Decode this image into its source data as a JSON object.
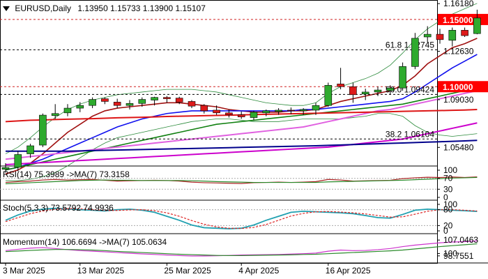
{
  "header": {
    "symbol": "EURUSD,Daily",
    "ohlc": "1.13950 1.15733 1.13900 1.15107"
  },
  "colors": {
    "bull": "#2eaa2e",
    "bear": "#dd1a1a",
    "ma_red": "#a01010",
    "ma_blue": "#1010ee",
    "ma_green": "#108010",
    "ma_pink": "#e060e0",
    "ma_darkred": "#dd1515",
    "ma_magenta": "#cc00cc",
    "ma_navy": "#00008b",
    "bb": "#2a8a3a",
    "grid": "#c0c0c0",
    "level_line": "#d02020",
    "price_tag_bg": "#ff0000",
    "rsi": "#aa2222",
    "rsi_ma": "#2a8a2a",
    "stoch_main": "#20a0b0",
    "stoch_signal": "#dd2222",
    "mom": "#cc33cc",
    "mom_ma": "#2a8a2a"
  },
  "chart_data": {
    "type": "candlestick",
    "x_ticks": [
      "3 Mar 2025",
      "13 Mar 2025",
      "25 Mar 2025",
      "4 Apr 2025",
      "16 Apr 2025"
    ],
    "y_ticks": [
      "1.16180",
      "1.12630",
      "1.09030",
      "1.05480"
    ],
    "ylim": [
      1.0425,
      1.1645
    ],
    "candles": [
      {
        "o": 1.0385,
        "h": 1.043,
        "l": 1.036,
        "c": 1.0398
      },
      {
        "o": 1.04,
        "h": 1.052,
        "l": 1.037,
        "c": 1.0495
      },
      {
        "o": 1.05,
        "h": 1.0575,
        "l": 1.047,
        "c": 1.056
      },
      {
        "o": 1.0565,
        "h": 1.08,
        "l": 1.055,
        "c": 1.0788
      },
      {
        "o": 1.0785,
        "h": 1.087,
        "l": 1.076,
        "c": 1.08
      },
      {
        "o": 1.0805,
        "h": 1.087,
        "l": 1.078,
        "c": 1.084
      },
      {
        "o": 1.084,
        "h": 1.0885,
        "l": 1.081,
        "c": 1.086
      },
      {
        "o": 1.086,
        "h": 1.092,
        "l": 1.084,
        "c": 1.0905
      },
      {
        "o": 1.091,
        "h": 1.092,
        "l": 1.087,
        "c": 1.089
      },
      {
        "o": 1.0885,
        "h": 1.091,
        "l": 1.084,
        "c": 1.086
      },
      {
        "o": 1.086,
        "h": 1.09,
        "l": 1.083,
        "c": 1.0875
      },
      {
        "o": 1.0875,
        "h": 1.092,
        "l": 1.085,
        "c": 1.0905
      },
      {
        "o": 1.09,
        "h": 1.0925,
        "l": 1.086,
        "c": 1.092
      },
      {
        "o": 1.092,
        "h": 1.093,
        "l": 1.088,
        "c": 1.091
      },
      {
        "o": 1.0915,
        "h": 1.0925,
        "l": 1.087,
        "c": 1.0885
      },
      {
        "o": 1.089,
        "h": 1.09,
        "l": 1.084,
        "c": 1.0855
      },
      {
        "o": 1.086,
        "h": 1.087,
        "l": 1.08,
        "c": 1.082
      },
      {
        "o": 1.0825,
        "h": 1.086,
        "l": 1.079,
        "c": 1.0805
      },
      {
        "o": 1.0805,
        "h": 1.083,
        "l": 1.077,
        "c": 1.079
      },
      {
        "o": 1.079,
        "h": 1.0815,
        "l": 1.076,
        "c": 1.0775
      },
      {
        "o": 1.077,
        "h": 1.082,
        "l": 1.075,
        "c": 1.081
      },
      {
        "o": 1.0805,
        "h": 1.083,
        "l": 1.078,
        "c": 1.082
      },
      {
        "o": 1.0815,
        "h": 1.084,
        "l": 1.079,
        "c": 1.0825
      },
      {
        "o": 1.0825,
        "h": 1.0845,
        "l": 1.0795,
        "c": 1.082
      },
      {
        "o": 1.082,
        "h": 1.084,
        "l": 1.079,
        "c": 1.083
      },
      {
        "o": 1.0825,
        "h": 1.088,
        "l": 1.079,
        "c": 1.086
      },
      {
        "o": 1.086,
        "h": 1.103,
        "l": 1.085,
        "c": 1.101
      },
      {
        "o": 1.102,
        "h": 1.114,
        "l": 1.098,
        "c": 1.1
      },
      {
        "o": 1.1,
        "h": 1.103,
        "l": 1.088,
        "c": 1.094
      },
      {
        "o": 1.0945,
        "h": 1.0985,
        "l": 1.09,
        "c": 1.096
      },
      {
        "o": 1.096,
        "h": 1.1,
        "l": 1.093,
        "c": 1.0975
      },
      {
        "o": 1.097,
        "h": 1.101,
        "l": 1.094,
        "c": 1.099
      },
      {
        "o": 1.099,
        "h": 1.118,
        "l": 1.097,
        "c": 1.115
      },
      {
        "o": 1.115,
        "h": 1.14,
        "l": 1.113,
        "c": 1.136
      },
      {
        "o": 1.137,
        "h": 1.145,
        "l": 1.133,
        "c": 1.139
      },
      {
        "o": 1.139,
        "h": 1.143,
        "l": 1.132,
        "c": 1.135
      },
      {
        "o": 1.1345,
        "h": 1.144,
        "l": 1.13,
        "c": 1.142
      },
      {
        "o": 1.142,
        "h": 1.144,
        "l": 1.137,
        "c": 1.138
      },
      {
        "o": 1.1395,
        "h": 1.1573,
        "l": 1.139,
        "c": 1.1511
      }
    ],
    "ma_lines": [
      {
        "color": "ma_red",
        "values": [
          1.035,
          1.038,
          1.043,
          1.05,
          1.058,
          1.066,
          1.072,
          1.078,
          1.082,
          1.084,
          1.085,
          1.086,
          1.087,
          1.088,
          1.088,
          1.087,
          1.086,
          1.085,
          1.083,
          1.082,
          1.081,
          1.081,
          1.081,
          1.082,
          1.082,
          1.083,
          1.086,
          1.089,
          1.091,
          1.093,
          1.095,
          1.097,
          1.101,
          1.108,
          1.117,
          1.123,
          1.129,
          1.132,
          1.136
        ]
      },
      {
        "color": "ma_blue",
        "values": [
          1.038,
          1.04,
          1.043,
          1.046,
          1.05,
          1.054,
          1.058,
          1.062,
          1.066,
          1.07,
          1.073,
          1.076,
          1.078,
          1.08,
          1.081,
          1.082,
          1.082,
          1.082,
          1.082,
          1.082,
          1.082,
          1.082,
          1.082,
          1.082,
          1.083,
          1.083,
          1.084,
          1.085,
          1.086,
          1.087,
          1.088,
          1.089,
          1.091,
          1.096,
          1.102,
          1.108,
          1.114,
          1.119,
          1.124
        ]
      },
      {
        "color": "ma_green",
        "values": [
          1.038,
          1.04,
          1.042,
          1.044,
          1.046,
          1.048,
          1.05,
          1.052,
          1.054,
          1.056,
          1.058,
          1.06,
          1.062,
          1.064,
          1.066,
          1.068,
          1.07,
          1.072,
          1.073,
          1.074,
          1.075,
          1.076,
          1.077,
          1.078,
          1.079,
          1.08,
          1.081,
          1.082,
          1.083,
          1.084,
          1.085,
          1.086,
          1.087,
          1.089,
          1.091,
          1.093,
          1.095,
          1.097,
          1.099
        ]
      },
      {
        "color": "ma_pink",
        "values": [
          1.046,
          1.047,
          1.048,
          1.049,
          1.05,
          1.051,
          1.052,
          1.053,
          1.054,
          1.055,
          1.056,
          1.057,
          1.058,
          1.059,
          1.06,
          1.061,
          1.062,
          1.063,
          1.064,
          1.065,
          1.066,
          1.067,
          1.068,
          1.069,
          1.07,
          1.072,
          1.074,
          1.076,
          1.078,
          1.08,
          1.082,
          1.083,
          1.085,
          1.087,
          1.089,
          1.091,
          1.093,
          1.095,
          1.097
        ]
      },
      {
        "color": "ma_darkred",
        "values": [
          1.074,
          1.0745,
          1.075,
          1.0752,
          1.0755,
          1.0758,
          1.076,
          1.0762,
          1.0765,
          1.0768,
          1.077,
          1.0772,
          1.0775,
          1.0778,
          1.078,
          1.0782,
          1.0784,
          1.0786,
          1.0788,
          1.079,
          1.0792,
          1.0794,
          1.0796,
          1.0798,
          1.08,
          1.0802,
          1.0804,
          1.0806,
          1.0808,
          1.081,
          1.0812,
          1.0814,
          1.0816,
          1.0818,
          1.082,
          1.0822,
          1.0824,
          1.0826,
          1.083
        ]
      },
      {
        "color": "ma_magenta",
        "values": [
          1.042,
          1.0425,
          1.043,
          1.0435,
          1.044,
          1.0445,
          1.045,
          1.0455,
          1.046,
          1.0465,
          1.047,
          1.0475,
          1.048,
          1.0485,
          1.049,
          1.0495,
          1.05,
          1.0505,
          1.051,
          1.0515,
          1.052,
          1.0525,
          1.053,
          1.0535,
          1.054,
          1.0545,
          1.055,
          1.056,
          1.057,
          1.058,
          1.059,
          1.06,
          1.061,
          1.063,
          1.065,
          1.067,
          1.069,
          1.071,
          1.073
        ]
      },
      {
        "color": "ma_navy",
        "values": [
          1.052,
          1.052,
          1.052,
          1.052,
          1.052,
          1.052,
          1.0522,
          1.0524,
          1.0526,
          1.0528,
          1.053,
          1.0532,
          1.0534,
          1.0536,
          1.0538,
          1.054,
          1.0542,
          1.0544,
          1.0546,
          1.0548,
          1.055,
          1.0552,
          1.0554,
          1.0556,
          1.0558,
          1.056,
          1.0563,
          1.0566,
          1.0569,
          1.0572,
          1.0575,
          1.0578,
          1.0581,
          1.0584,
          1.0587,
          1.059,
          1.0593,
          1.0596,
          1.06
        ]
      }
    ],
    "bollinger": {
      "upper": [
        1.05,
        1.055,
        1.062,
        1.07,
        1.077,
        1.083,
        1.087,
        1.09,
        1.092,
        1.094,
        1.095,
        1.096,
        1.097,
        1.098,
        1.098,
        1.098,
        1.097,
        1.096,
        1.094,
        1.092,
        1.09,
        1.088,
        1.087,
        1.086,
        1.086,
        1.088,
        1.095,
        1.1,
        1.103,
        1.106,
        1.11,
        1.116,
        1.125,
        1.135,
        1.143,
        1.149,
        1.154,
        1.158,
        1.162
      ],
      "lower": [
        1.03,
        1.03,
        1.031,
        1.033,
        1.036,
        1.041,
        1.047,
        1.053,
        1.058,
        1.062,
        1.064,
        1.066,
        1.068,
        1.07,
        1.072,
        1.074,
        1.075,
        1.076,
        1.076,
        1.075,
        1.074,
        1.074,
        1.074,
        1.075,
        1.076,
        1.076,
        1.076,
        1.076,
        1.077,
        1.078,
        1.08,
        1.08,
        1.078,
        1.071,
        1.066,
        1.064,
        1.063,
        1.064,
        1.065
      ]
    },
    "levels": [
      {
        "value": 1.15,
        "style": "dashed-red",
        "label": "",
        "tag": "1.15000"
      },
      {
        "value": 1.12745,
        "style": "dashed-black",
        "label": "61.8 1.12745",
        "tag": ""
      },
      {
        "value": 1.1,
        "style": "dashed-red",
        "label": "",
        "tag": "1.10000"
      },
      {
        "value": 1.09424,
        "style": "dashed-black",
        "label": "50.0 1.09424",
        "tag": ""
      },
      {
        "value": 1.06104,
        "style": "dashed-black",
        "label": "38.2 1.06104",
        "tag": ""
      }
    ],
    "indicators": [
      {
        "name": "RSI",
        "label": "RSI(14) 75.3989 ->MA(7) 73.3158",
        "ticks": [
          "100",
          "70",
          "30",
          "0"
        ],
        "ylim": [
          0,
          100
        ],
        "dashed": [
          70,
          30
        ],
        "series": [
          {
            "color": "rsi",
            "values": [
              55,
              58,
              60,
              64,
              66,
              64,
              65,
              66,
              63,
              60,
              61,
              62,
              63,
              62,
              60,
              56,
              54,
              53,
              52,
              51,
              54,
              55,
              56,
              55,
              56,
              58,
              66,
              64,
              60,
              61,
              62,
              63,
              69,
              72,
              74,
              73,
              75,
              73,
              75.3989
            ]
          },
          {
            "color": "rsi_ma",
            "values": [
              50,
              52,
              54,
              56,
              58,
              60,
              62,
              63,
              64,
              63,
              63,
              62,
              62,
              62,
              62,
              61,
              60,
              58,
              57,
              56,
              55,
              55,
              55,
              55,
              55,
              55,
              57,
              58,
              59,
              60,
              61,
              62,
              63,
              65,
              67,
              69,
              71,
              72,
              73.3158
            ]
          }
        ]
      },
      {
        "name": "Stoch",
        "label": "Stoch(5,3,3) 73.5792 74.9936",
        "ticks": [
          "100",
          "80",
          "20",
          "0"
        ],
        "ylim": [
          0,
          100
        ],
        "dashed": [
          80,
          20
        ],
        "series": [
          {
            "color": "stoch_main",
            "values": [
              40,
              60,
              75,
              82,
              85,
              83,
              80,
              78,
              75,
              80,
              82,
              78,
              70,
              55,
              40,
              22,
              12,
              10,
              8,
              10,
              22,
              40,
              55,
              70,
              74,
              72,
              70,
              68,
              65,
              58,
              50,
              48,
              62,
              78,
              82,
              80,
              78,
              76,
              73.5792
            ]
          },
          {
            "color": "stoch_signal",
            "values": [
              35,
              50,
              65,
              75,
              82,
              84,
              83,
              80,
              77,
              77,
              79,
              80,
              76,
              68,
              55,
              39,
              25,
              15,
              10,
              9,
              13,
              24,
              40,
              56,
              66,
              72,
              73,
              71,
              68,
              64,
              58,
              52,
              53,
              63,
              74,
              80,
              80,
              78,
              74.9936
            ]
          }
        ]
      },
      {
        "name": "Momentum",
        "label": "Momentum(14) 106.6694 ->MA(7) 105.0634",
        "ticks": [
          "107.0463",
          "98.7551",
          "100"
        ],
        "ylim": [
          96.5,
          108.2
        ],
        "dashed": [],
        "series": [
          {
            "color": "mom",
            "values": [
              101.5,
              102.2,
              102.8,
              103.1,
              102.6,
              102.0,
              101.5,
              101.2,
              100.9,
              100.5,
              100.1,
              99.8,
              99.5,
              99.2,
              98.9,
              98.7,
              98.7,
              98.8,
              99.0,
              99.2,
              99.3,
              99.4,
              99.5,
              99.7,
              99.9,
              100.2,
              101.2,
              101.8,
              101.5,
              101.6,
              102.0,
              102.6,
              103.6,
              104.4,
              105.0,
              105.6,
              106.0,
              106.2,
              106.6694
            ]
          },
          {
            "color": "mom_ma",
            "values": [
              101.0,
              101.3,
              101.6,
              101.9,
              102.1,
              102.1,
              102.0,
              101.8,
              101.5,
              101.1,
              100.8,
              100.5,
              100.2,
              99.9,
              99.6,
              99.4,
              99.2,
              99.0,
              98.9,
              98.9,
              99.0,
              99.1,
              99.2,
              99.3,
              99.5,
              99.6,
              99.9,
              100.2,
              100.5,
              100.8,
              101.1,
              101.4,
              101.8,
              102.4,
              103.0,
              103.6,
              104.1,
              104.6,
              105.0634
            ]
          }
        ]
      }
    ]
  }
}
